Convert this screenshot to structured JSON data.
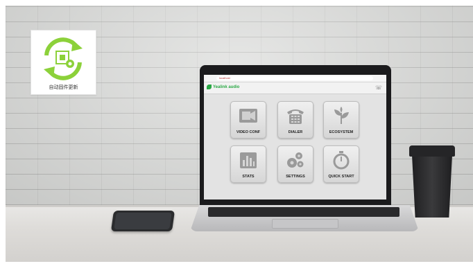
{
  "badge": {
    "label": "自动固件更新",
    "accent": "#8cd13a"
  },
  "browser": {
    "url": "localhost"
  },
  "app": {
    "logo_text": "Yealink audio"
  },
  "tiles": [
    {
      "label": "VIDEO CONF",
      "icon": "video-camera-icon"
    },
    {
      "label": "DIALER",
      "icon": "telephone-icon"
    },
    {
      "label": "ECOSYSTEM",
      "icon": "plant-icon"
    },
    {
      "label": "STATS",
      "icon": "bar-chart-icon"
    },
    {
      "label": "SETTINGS",
      "icon": "gears-icon"
    },
    {
      "label": "QUICK START",
      "icon": "stopwatch-icon"
    }
  ]
}
